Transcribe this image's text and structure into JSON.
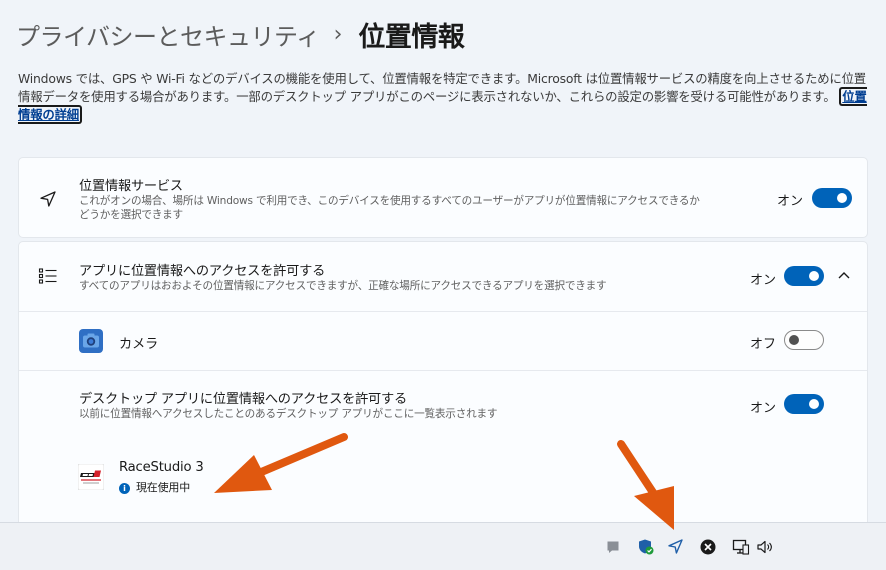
{
  "breadcrumb": {
    "parent": "プライバシーとセキュリティ",
    "separator": "›",
    "current": "位置情報"
  },
  "description": {
    "text": "Windows では、GPS や Wi-Fi などのデバイスの機能を使用して、位置情報を特定できます。Microsoft は位置情報サービスの精度を向上させるために位置情報データを使用する場合があります。一部のデスクトップ アプリがこのページに表示されないか、これらの設定の影響を受ける可能性があります。",
    "link": "位置情報の詳細"
  },
  "location_services": {
    "icon": "location-arrow-icon",
    "title": "位置情報サービス",
    "description": "これがオンの場合、場所は Windows で利用でき、このデバイスを使用するすべてのユーザーがアプリが位置情報にアクセスできるかどうかを選択できます",
    "state": "オン",
    "enabled": true
  },
  "app_access": {
    "icon": "app-list-icon",
    "title": "アプリに位置情報へのアクセスを許可する",
    "description": "すべてのアプリはおおよその位置情報にアクセスできますが、正確な場所にアクセスできるアプリを選択できます",
    "state": "オン",
    "enabled": true,
    "expanded": true,
    "apps": [
      {
        "name": "カメラ",
        "icon": "camera-app-icon",
        "state": "オフ",
        "enabled": false
      }
    ]
  },
  "desktop_access": {
    "title": "デスクトップ アプリに位置情報へのアクセスを許可する",
    "description": "以前に位置情報へアクセスしたことのあるデスクトップ アプリがここに一覧表示されます",
    "state": "オン",
    "enabled": true,
    "apps": [
      {
        "name": "RaceStudio 3",
        "icon": "racestudio-logo-icon",
        "status": "現在使用中",
        "status_icon": "info-icon"
      }
    ]
  },
  "taskbar": {
    "tray_icons": [
      "notification-icon",
      "defender-shield-icon",
      "location-in-use-icon",
      "close-circle-icon",
      "display-icon",
      "volume-icon"
    ]
  },
  "colors": {
    "accent": "#0063b9",
    "annotation_arrow": "#e0580f",
    "background": "#f0f4f9",
    "card": "#fbfdff"
  }
}
